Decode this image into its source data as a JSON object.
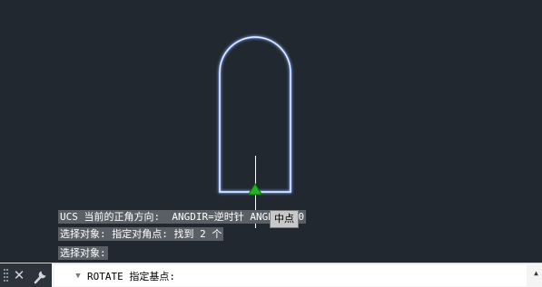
{
  "history": {
    "line1": "UCS 当前的正角方向:  ANGDIR=逆时针 ANGBASE=0",
    "line2": "选择对象: 指定对角点: 找到 2 个",
    "line3": "选择对象:"
  },
  "snap_tooltip": "中点",
  "command": {
    "prompt": "ROTATE 指定基点:",
    "close_icon": "close-icon",
    "customize_icon": "wrench-icon",
    "recent_icon": "chevron-down-icon",
    "scroll_icon": "triangle-up-icon"
  },
  "colors": {
    "canvas_background": "#212830",
    "shape_outline": "#8fb0ff",
    "snap_marker": "#1fb41f",
    "crosshair": "#ffffff"
  }
}
